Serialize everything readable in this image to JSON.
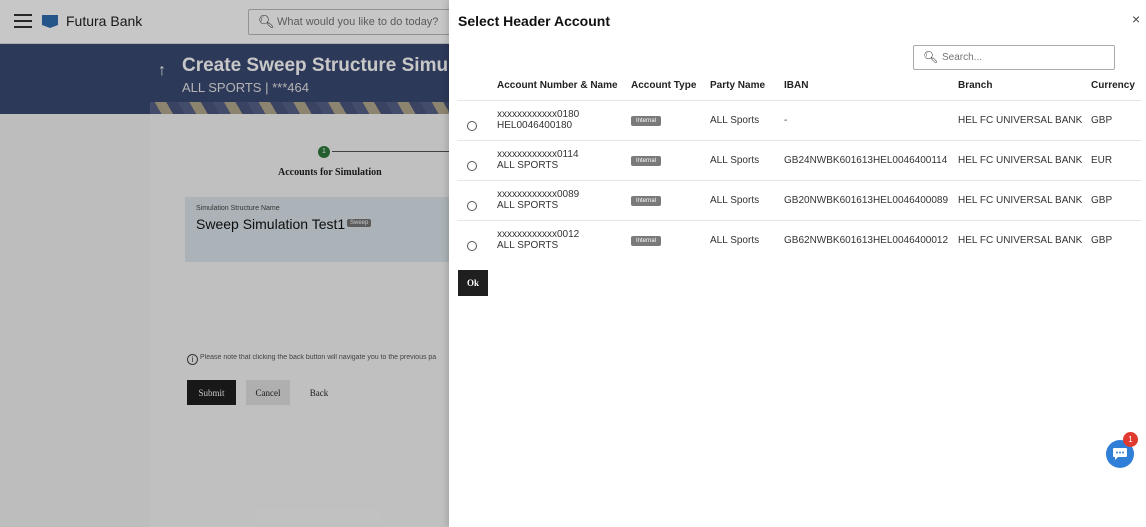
{
  "app": {
    "brand": "Futura Bank",
    "search_placeholder": "What would you like to do today?"
  },
  "page": {
    "title": "Create Sweep Structure Simulatio",
    "subtitle": "ALL SPORTS | ***464",
    "step_number": "1",
    "step_label": "Accounts for Simulation",
    "sim_caption": "Simulation Structure Name",
    "sim_name": "Sweep Simulation Test1",
    "sim_badge": "Sweep",
    "note": "Please note that clicking the back button will navigate you to the previous pa",
    "buttons": {
      "submit": "Submit",
      "cancel": "Cancel",
      "back": "Back"
    }
  },
  "modal": {
    "title": "Select Header Account",
    "close": "×",
    "search_placeholder": "Search...",
    "columns": [
      "Account Number & Name",
      "Account Type",
      "Party Name",
      "IBAN",
      "Branch",
      "Currency"
    ],
    "rows": [
      {
        "account_number": "xxxxxxxxxxxx0180",
        "account_name": "HEL0046400180",
        "type": "Internal",
        "party": "ALL Sports",
        "iban": "-",
        "branch": "HEL FC UNIVERSAL BANK",
        "currency": "GBP"
      },
      {
        "account_number": "xxxxxxxxxxxx0114",
        "account_name": "ALL SPORTS",
        "type": "Internal",
        "party": "ALL Sports",
        "iban": "GB24NWBK601613HEL0046400114",
        "branch": "HEL FC UNIVERSAL BANK",
        "currency": "EUR"
      },
      {
        "account_number": "xxxxxxxxxxxx0089",
        "account_name": "ALL SPORTS",
        "type": "Internal",
        "party": "ALL Sports",
        "iban": "GB20NWBK601613HEL0046400089",
        "branch": "HEL FC UNIVERSAL BANK",
        "currency": "GBP"
      },
      {
        "account_number": "xxxxxxxxxxxx0012",
        "account_name": "ALL SPORTS",
        "type": "Internal",
        "party": "ALL Sports",
        "iban": "GB62NWBK601613HEL0046400012",
        "branch": "HEL FC UNIVERSAL BANK",
        "currency": "GBP"
      }
    ],
    "ok_label": "Ok"
  },
  "chat": {
    "count": "1"
  },
  "colors": {
    "hero": "#3a4a72",
    "primary_button": "#1f1f1f",
    "chat": "#2f7fd8",
    "notification": "#e03a2f",
    "step_done": "#2d7a3a"
  },
  "icons": {
    "menu": "hamburger-icon",
    "search": "search-icon",
    "close": "close-icon",
    "chat": "chat-icon",
    "info": "info-icon"
  }
}
